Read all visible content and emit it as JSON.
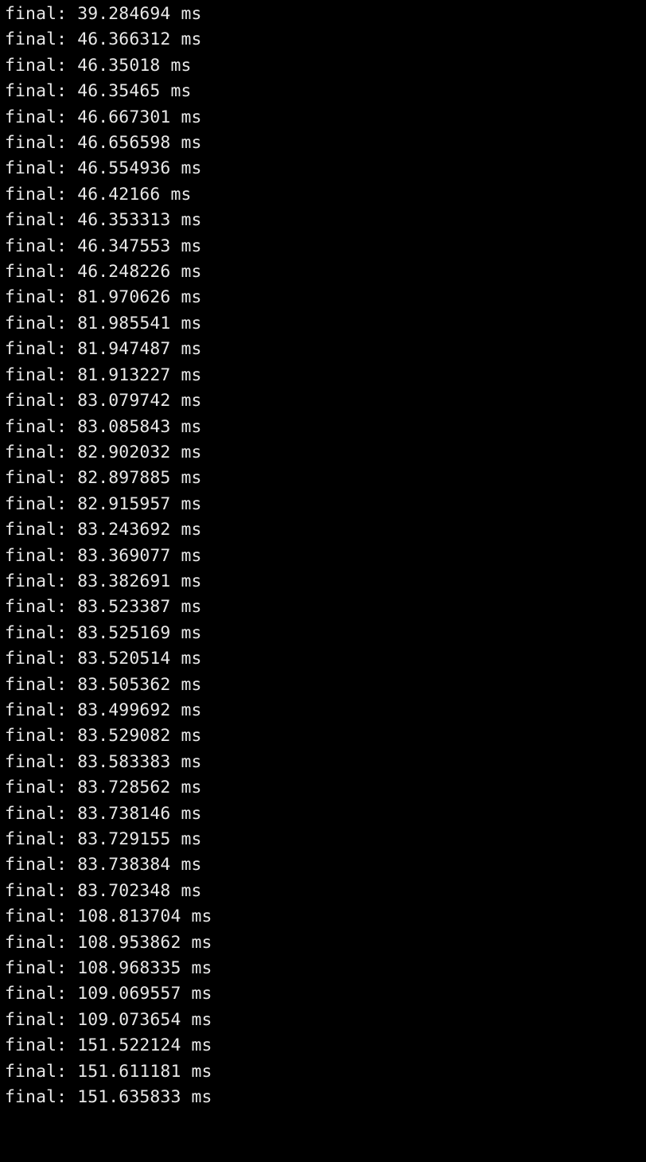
{
  "terminal": {
    "label": "final:",
    "unit": "ms",
    "lines": [
      "39.284694",
      "46.366312",
      "46.35018",
      "46.35465",
      "46.667301",
      "46.656598",
      "46.554936",
      "46.42166",
      "46.353313",
      "46.347553",
      "46.248226",
      "81.970626",
      "81.985541",
      "81.947487",
      "81.913227",
      "83.079742",
      "83.085843",
      "82.902032",
      "82.897885",
      "82.915957",
      "83.243692",
      "83.369077",
      "83.382691",
      "83.523387",
      "83.525169",
      "83.520514",
      "83.505362",
      "83.499692",
      "83.529082",
      "83.583383",
      "83.728562",
      "83.738146",
      "83.729155",
      "83.738384",
      "83.702348",
      "108.813704",
      "108.953862",
      "108.968335",
      "109.069557",
      "109.073654",
      "151.522124",
      "151.611181",
      "151.635833"
    ]
  }
}
